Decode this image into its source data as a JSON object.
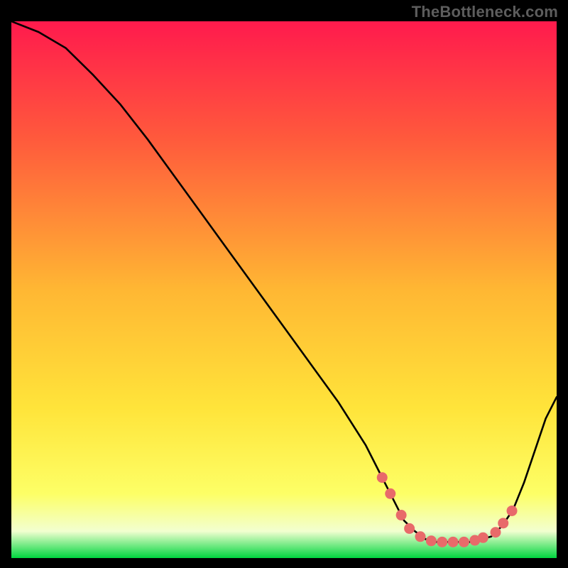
{
  "watermark": "TheBottleneck.com",
  "colors": {
    "background": "#000000",
    "gradient_top": "#ff1a4d",
    "gradient_upper": "#ff5a3c",
    "gradient_mid": "#ffb733",
    "gradient_lower": "#ffe43a",
    "gradient_near_bottom": "#fdff66",
    "gradient_pale": "#f2ffd0",
    "gradient_green": "#00d63f",
    "curve": "#000000",
    "markers": "#e86a6a"
  },
  "chart_data": {
    "type": "line",
    "title": "",
    "xlabel": "",
    "ylabel": "",
    "xlim": [
      0,
      100
    ],
    "ylim": [
      0,
      100
    ],
    "series": [
      {
        "name": "bottleneck-curve",
        "x": [
          0,
          5,
          10,
          15,
          20,
          25,
          30,
          35,
          40,
          45,
          50,
          55,
          60,
          65,
          68,
          70,
          72,
          74,
          76,
          78,
          80,
          82,
          84,
          86,
          88,
          90,
          92,
          94,
          96,
          98,
          100
        ],
        "y": [
          100,
          98,
          95,
          90,
          84.5,
          78,
          71,
          64,
          57,
          50,
          43,
          36,
          29,
          21,
          15,
          11,
          7,
          5,
          3.5,
          3,
          3,
          3,
          3,
          3.5,
          4,
          6,
          9,
          14,
          20,
          26,
          30
        ]
      }
    ],
    "markers": {
      "name": "highlight-dots",
      "x": [
        68.0,
        69.5,
        71.5,
        73.0,
        75.0,
        77.0,
        79.0,
        81.0,
        83.0,
        85.0,
        86.5,
        88.8,
        90.2,
        91.8
      ],
      "y": [
        15.0,
        12.0,
        8.0,
        5.5,
        4.0,
        3.2,
        3.0,
        3.0,
        3.0,
        3.3,
        3.8,
        4.8,
        6.5,
        8.8
      ]
    }
  }
}
